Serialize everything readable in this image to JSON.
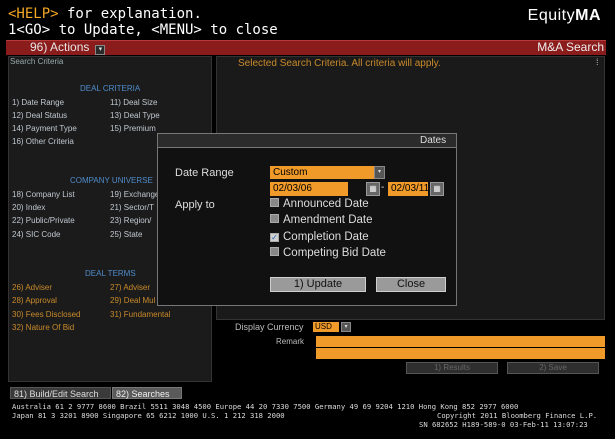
{
  "header": {
    "help_tag": "<HELP>",
    "help_text": " for explanation.",
    "go_line": "1<GO> to Update, <MENU> to close",
    "brand_regular": "Equity",
    "brand_bold": "MA"
  },
  "menubar": {
    "actions_label": "96) Actions",
    "arrow": "▾",
    "title": "M&A Search",
    "bg_color": "#8b1c1c"
  },
  "left_panel": {
    "header": "Search Criteria",
    "deal_criteria": {
      "title": "DEAL CRITERIA",
      "items": [
        "1) Date Range",
        "11) Deal Size",
        "12) Deal Status",
        "13) Deal Type",
        "14) Payment Type",
        "15) Premium",
        "16) Other Criteria"
      ]
    },
    "company_universe": {
      "title": "COMPANY UNIVERSE",
      "items": [
        "18) Company List",
        "19) Exchange",
        "20) Index",
        "21) Sector/T",
        "22) Public/Private",
        "23) Region/",
        "24) SIC Code",
        "25) State"
      ]
    },
    "deal_terms": {
      "title": "DEAL TERMS",
      "items": [
        "26) Adviser",
        "27) Adviser",
        "28) Approval",
        "29) Deal Mul",
        "30) Fees Disclosed",
        "31) Fundamental",
        "32) Nature Of Bid"
      ]
    }
  },
  "right_panel": {
    "message": "Selected Search Criteria. All criteria will apply.",
    "scroll_mark": "⁞"
  },
  "options": {
    "currency_label": "Display Currency",
    "currency_value": "USD",
    "remark_label": "Remark",
    "results_button": "1) Results",
    "save_button": "2) Save"
  },
  "tabs": {
    "build_edit": "81) Build/Edit Search",
    "searches": "82) Searches"
  },
  "footer": {
    "line1": "Australia 61 2 9777 8600 Brazil 5511 3048 4500 Europe 44 20 7330 7500 Germany 49 69 9204 1210 Hong Kong 852 2977 6000",
    "line2": "Japan 81 3 3201 8900         Singapore 65 6212 1000        U.S. 1 212 318 2000",
    "line3": "Copyright 2011 Bloomberg Finance L.P.",
    "line4": "SN 682652 H189-589-0 03-Feb-11 13:07:23"
  },
  "dialog": {
    "title": "Dates",
    "date_range_label": "Date Range",
    "date_range_value": "Custom",
    "start_date": "02/03/06",
    "end_date": "02/03/11",
    "dash": "-",
    "calendar_glyph": "▦",
    "apply_to_label": "Apply to",
    "checkboxes": [
      {
        "label": "Announced Date",
        "checked": false
      },
      {
        "label": "Amendment Date",
        "checked": false
      },
      {
        "label": "Completion Date",
        "checked": true
      },
      {
        "label": "Competing Bid Date",
        "checked": false
      }
    ],
    "check_glyph": "✓",
    "update_button": "1) Update",
    "close_button": "Close"
  }
}
